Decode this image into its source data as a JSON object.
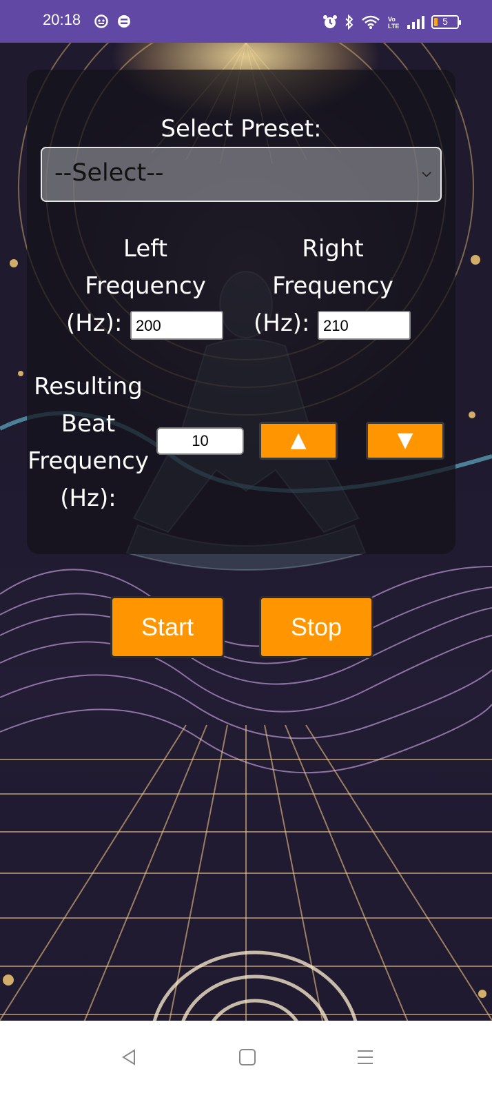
{
  "status_bar": {
    "time": "20:18",
    "left_icons": [
      "notification-app-icon",
      "notification-app-icon-2"
    ],
    "right_icons": [
      "alarm-icon",
      "bluetooth-icon",
      "wifi-icon",
      "volte-icon",
      "signal-icon",
      "battery-icon"
    ],
    "battery_level": "5",
    "bar_color": "#6148a5"
  },
  "preset": {
    "label": "Select Preset:",
    "selected": "--Select--"
  },
  "left_frequency": {
    "label_lines": [
      "Left",
      "Frequency",
      "(Hz):"
    ],
    "value": "200"
  },
  "right_frequency": {
    "label_lines": [
      "Right",
      "Frequency",
      "(Hz):"
    ],
    "value": "210"
  },
  "beat_frequency": {
    "label_lines": [
      "Resulting",
      "Beat",
      "Frequency",
      "(Hz):"
    ],
    "value": "10",
    "increase_label": "▲",
    "decrease_label": "▼"
  },
  "actions": {
    "start_label": "Start",
    "stop_label": "Stop",
    "accent_color": "#ff9500"
  },
  "nav": {
    "icons": [
      "back-icon",
      "home-icon",
      "menu-icon"
    ]
  }
}
